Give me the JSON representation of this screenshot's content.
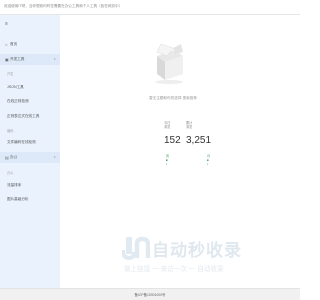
{
  "topbar": {
    "welcome": "欢迎使用IT吧，当你想到何时在需要在办公工具和个人工具（各在网页中）"
  },
  "sidebar": {
    "menu_icon": "menu-icon",
    "home": {
      "icon": "home-icon",
      "label": "首页"
    },
    "dev_tools": {
      "icon": "folder-icon",
      "label": "开发工具",
      "arrow": "chevron-up-icon",
      "section_label": "开发",
      "items": [
        "JSON工具",
        "在线正则检测",
        "正则表达式在线工具"
      ],
      "section2_label": "编码",
      "items2": [
        "文件编码在线检测"
      ]
    },
    "office": {
      "icon": "briefcase-icon",
      "label": "办公",
      "arrow": "chevron-up-icon",
      "section_label": "办公",
      "items": [
        "流量排序",
        "图片高级分析"
      ]
    }
  },
  "main": {
    "illustration": "empty-box-illustration",
    "tagline": "暂无主题和你的选择 搜索推荐",
    "stats": [
      {
        "label_lines": [
          "今日",
          "浏览"
        ],
        "value": "152"
      },
      {
        "label_lines": [
          "累计",
          "浏览"
        ],
        "value": "3,251"
      }
    ],
    "mini_bars": [
      {
        "label": "周"
      },
      {
        "label": "月"
      }
    ]
  },
  "watermark": {
    "title": "自动秒收录",
    "subtitle": "做上链接 一 来访一次 一 自动收录"
  },
  "footer": {
    "text": "备ICP备10001000号"
  }
}
